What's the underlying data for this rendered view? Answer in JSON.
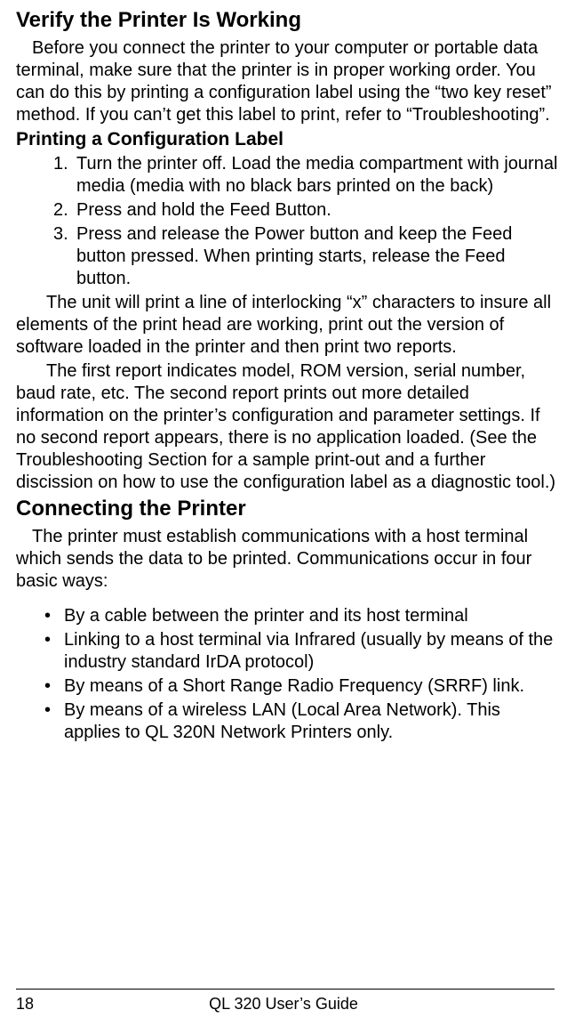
{
  "section1": {
    "heading": "Verify the Printer Is Working",
    "intro": "Before you connect the printer to your computer or portable data terminal, make sure that the printer is in proper working order.  You can do this by printing a configuration label using the “two key reset” method.  If you can’t get this label to print, refer to “Troubleshooting”.",
    "subheading": "Printing a Configuration Label",
    "steps": [
      {
        "num": "1.",
        "text": "Turn the printer off.  Load the media compartment with journal media (media with no black bars printed on the back)"
      },
      {
        "num": "2.",
        "text": "Press and hold the Feed Button."
      },
      {
        "num": "3.",
        "text": "Press and release the Power button and keep the Feed button pressed.  When printing starts, release the Feed button."
      }
    ],
    "after_para1": "The unit will print a  line of interlocking “x” characters to insure all elements of the print head are working, print out the version of software loaded in the printer and then print two reports.",
    "after_para2": "The first report indicates model, ROM version, serial number, baud rate, etc.    The second report prints out more detailed information on the printer’s configuration and parameter settings.  If no second report appears, there is no application loaded. (See the Troubleshooting Section for a sample print-out and a further discission on how to use the configuration label as a diagnostic tool.)"
  },
  "section2": {
    "heading": "Connecting the Printer",
    "intro": "The printer must establish communications with a host terminal which sends the data to be printed.  Communications occur in four basic ways:",
    "bullets": [
      "By a cable between the printer and its host terminal",
      "Linking to a host terminal via Infrared (usually by means of the industry standard IrDA protocol)",
      "By means of a Short Range Radio Frequency (SRRF) link.",
      "By means of a wireless LAN (Local Area Network).  This applies to QL 320N  Network Printers only."
    ]
  },
  "footer": {
    "page_number": "18",
    "title": "QL 320 User’s Guide"
  },
  "bullet_char": "•"
}
